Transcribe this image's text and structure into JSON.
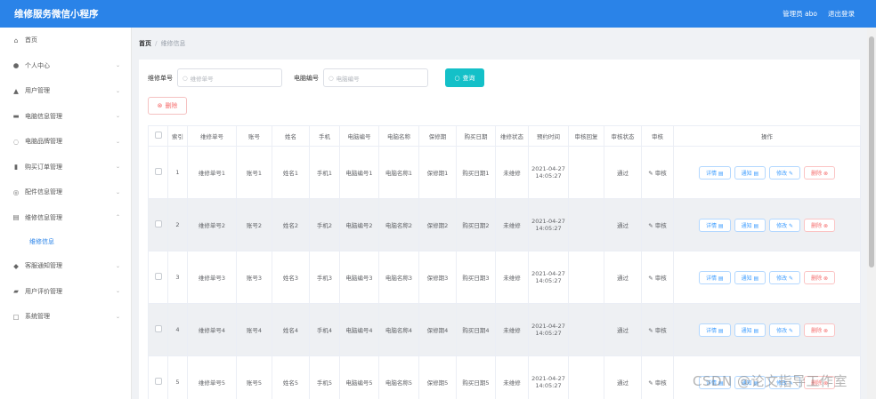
{
  "header": {
    "app_title": "维修服务微信小程序",
    "user_label": "管理员 abo",
    "logout_label": "退出登录"
  },
  "sidebar": {
    "items": [
      {
        "label": "首页",
        "icon": "home-icon"
      },
      {
        "label": "个人中心",
        "icon": "user-icon"
      },
      {
        "label": "用户管理",
        "icon": "users-icon"
      },
      {
        "label": "电脑信息管理",
        "icon": "computer-icon"
      },
      {
        "label": "电脑品牌管理",
        "icon": "tag-icon"
      },
      {
        "label": "购买订单管理",
        "icon": "chart-icon"
      },
      {
        "label": "配件信息管理",
        "icon": "parts-icon"
      },
      {
        "label": "维修信息管理",
        "icon": "repair-icon"
      },
      {
        "label": "维修信息",
        "icon": ""
      },
      {
        "label": "客服通知管理",
        "icon": "notify-icon"
      },
      {
        "label": "用户评价管理",
        "icon": "review-icon"
      },
      {
        "label": "系统管理",
        "icon": "system-icon"
      }
    ]
  },
  "breadcrumb": {
    "home": "首页",
    "separator": "/",
    "current": "维修信息"
  },
  "search": {
    "field1_label": "维修单号",
    "field1_placeholder": "维修单号",
    "field2_label": "电脑编号",
    "field2_placeholder": "电脑编号",
    "query_label": "查询",
    "delete_label": "删除"
  },
  "table": {
    "headers": [
      "",
      "索引",
      "维修单号",
      "账号",
      "姓名",
      "手机",
      "电脑编号",
      "电脑名称",
      "保修期",
      "购买日期",
      "维修状态",
      "预约时间",
      "审核回复",
      "审核状态",
      "审核",
      "操作"
    ],
    "rows": [
      {
        "index": "1",
        "order_no": "维修单号1",
        "account": "账号1",
        "name": "姓名1",
        "phone": "手机1",
        "pc_no": "电脑编号1",
        "pc_name": "电脑名称1",
        "warranty": "保修期1",
        "buy_date": "购买日期1",
        "status": "未维修",
        "time": "2021-04-27 14:05:27",
        "reply": "",
        "audit_status": "通过",
        "audit": "审核"
      },
      {
        "index": "2",
        "order_no": "维修单号2",
        "account": "账号2",
        "name": "姓名2",
        "phone": "手机2",
        "pc_no": "电脑编号2",
        "pc_name": "电脑名称2",
        "warranty": "保修期2",
        "buy_date": "购买日期2",
        "status": "未维修",
        "time": "2021-04-27 14:05:27",
        "reply": "",
        "audit_status": "通过",
        "audit": "审核"
      },
      {
        "index": "3",
        "order_no": "维修单号3",
        "account": "账号3",
        "name": "姓名3",
        "phone": "手机3",
        "pc_no": "电脑编号3",
        "pc_name": "电脑名称3",
        "warranty": "保修期3",
        "buy_date": "购买日期3",
        "status": "未维修",
        "time": "2021-04-27 14:05:27",
        "reply": "",
        "audit_status": "通过",
        "audit": "审核"
      },
      {
        "index": "4",
        "order_no": "维修单号4",
        "account": "账号4",
        "name": "姓名4",
        "phone": "手机4",
        "pc_no": "电脑编号4",
        "pc_name": "电脑名称4",
        "warranty": "保修期4",
        "buy_date": "购买日期4",
        "status": "未维修",
        "time": "2021-04-27 14:05:27",
        "reply": "",
        "audit_status": "通过",
        "audit": "审核"
      },
      {
        "index": "5",
        "order_no": "维修单号5",
        "account": "账号5",
        "name": "姓名5",
        "phone": "手机5",
        "pc_no": "电脑编号5",
        "pc_name": "电脑名称5",
        "warranty": "保修期5",
        "buy_date": "购买日期5",
        "status": "未维修",
        "time": "2021-04-27 14:05:27",
        "reply": "",
        "audit_status": "通过",
        "audit": "审核"
      }
    ],
    "actions": {
      "detail": "详情 ▤",
      "notify": "通知 ▤",
      "edit": "修改 ✎",
      "delete": "删除 ⊗"
    }
  },
  "watermark": "CSDN @论文指导工作室",
  "colors": {
    "header": "#2a83e8",
    "query": "#14c0c8",
    "danger": "#f56c6c",
    "primary": "#409eff",
    "audit": "#5cb85c"
  }
}
